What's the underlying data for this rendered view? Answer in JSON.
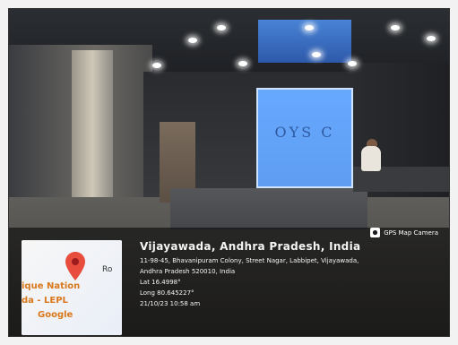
{
  "scene": {
    "screen_text": "OYS C"
  },
  "overlay": {
    "camera_badge": "GPS Map Camera",
    "map_thumb": {
      "label_line1": "ique Nation",
      "label_line2": "da - LEPL",
      "brand": "Google",
      "road": "Ro"
    },
    "place_title": "Vijayawada, Andhra Pradesh, India",
    "address_line1": "11-98-45, Bhavanipuram Colony, Street Nagar, Labbipet, Vijayawada,",
    "address_line2": "Andhra Pradesh 520010, India",
    "lat": "Lat 16.4998°",
    "long": "Long 80.645227°",
    "datetime": "21/10/23 10:58 am"
  },
  "colors": {
    "screen_blue": "#5e9df1",
    "pin_red": "#e74c3c",
    "map_label": "#d9771b"
  }
}
